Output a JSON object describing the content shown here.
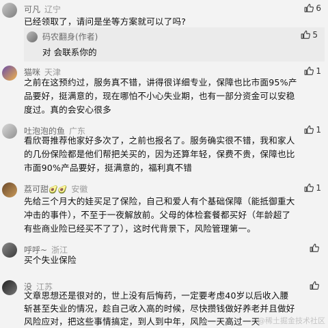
{
  "comments": [
    {
      "name": "可凡",
      "location": "辽宁",
      "text": "已经领取了，请问是坐等方案就可以了吗?",
      "likes": "6",
      "reply": {
        "name": "码农翻身(作者)",
        "text": "对 会联系你的",
        "likes": "5"
      }
    },
    {
      "name": "猫咪",
      "location": "天津",
      "text": "之前在这预约过，服务真不错，讲得很详细专业，保障也比市面95%产品要好，挺满意的，现在哪怕不小心失业期，也有一部分资金可以安稳度过。真的会安心很多",
      "likes": "1"
    },
    {
      "name": "吐泡泡的鱼",
      "location": "广东",
      "text": "看欣哥推荐他家好多次了，之前也报名了。服务确实很不错，我和家人的几份保险都是他们帮把关买的，因为还算年轻，保费不贵，保障也比市面90%产品要好，挺满意的，福利真不错",
      "likes": "1"
    },
    {
      "name": "荔可甜",
      "name_emoji": "🥑🥑",
      "location": "安徽",
      "text": "先给三个月大的娃买足了保险，自己和爱人有个基础保障（能抵御重大冲击的事件），不至于一夜解放前。父母的体检套餐都买好（年龄超了有些商业险已经买不了了），这时代背景下，风险管理第一。",
      "likes": "1"
    },
    {
      "name": "呼呼~",
      "location": "浙江",
      "text": "买个失业保险",
      "likes": ""
    },
    {
      "name": "没",
      "location": "江苏",
      "text": "文章思想还是很对的，世上没有后悔药，一定要考虑40岁以后收入腰斩甚至失业的情况，趁自己收入高的时候，尽快攒钱做好养老并且做好风险应对，把这些事情搞定，到人到中年，风险一天高过一天",
      "likes": ""
    }
  ],
  "watermark": "@稀土掘金技术社区",
  "icons": {
    "like": "thumbs-up-icon"
  }
}
